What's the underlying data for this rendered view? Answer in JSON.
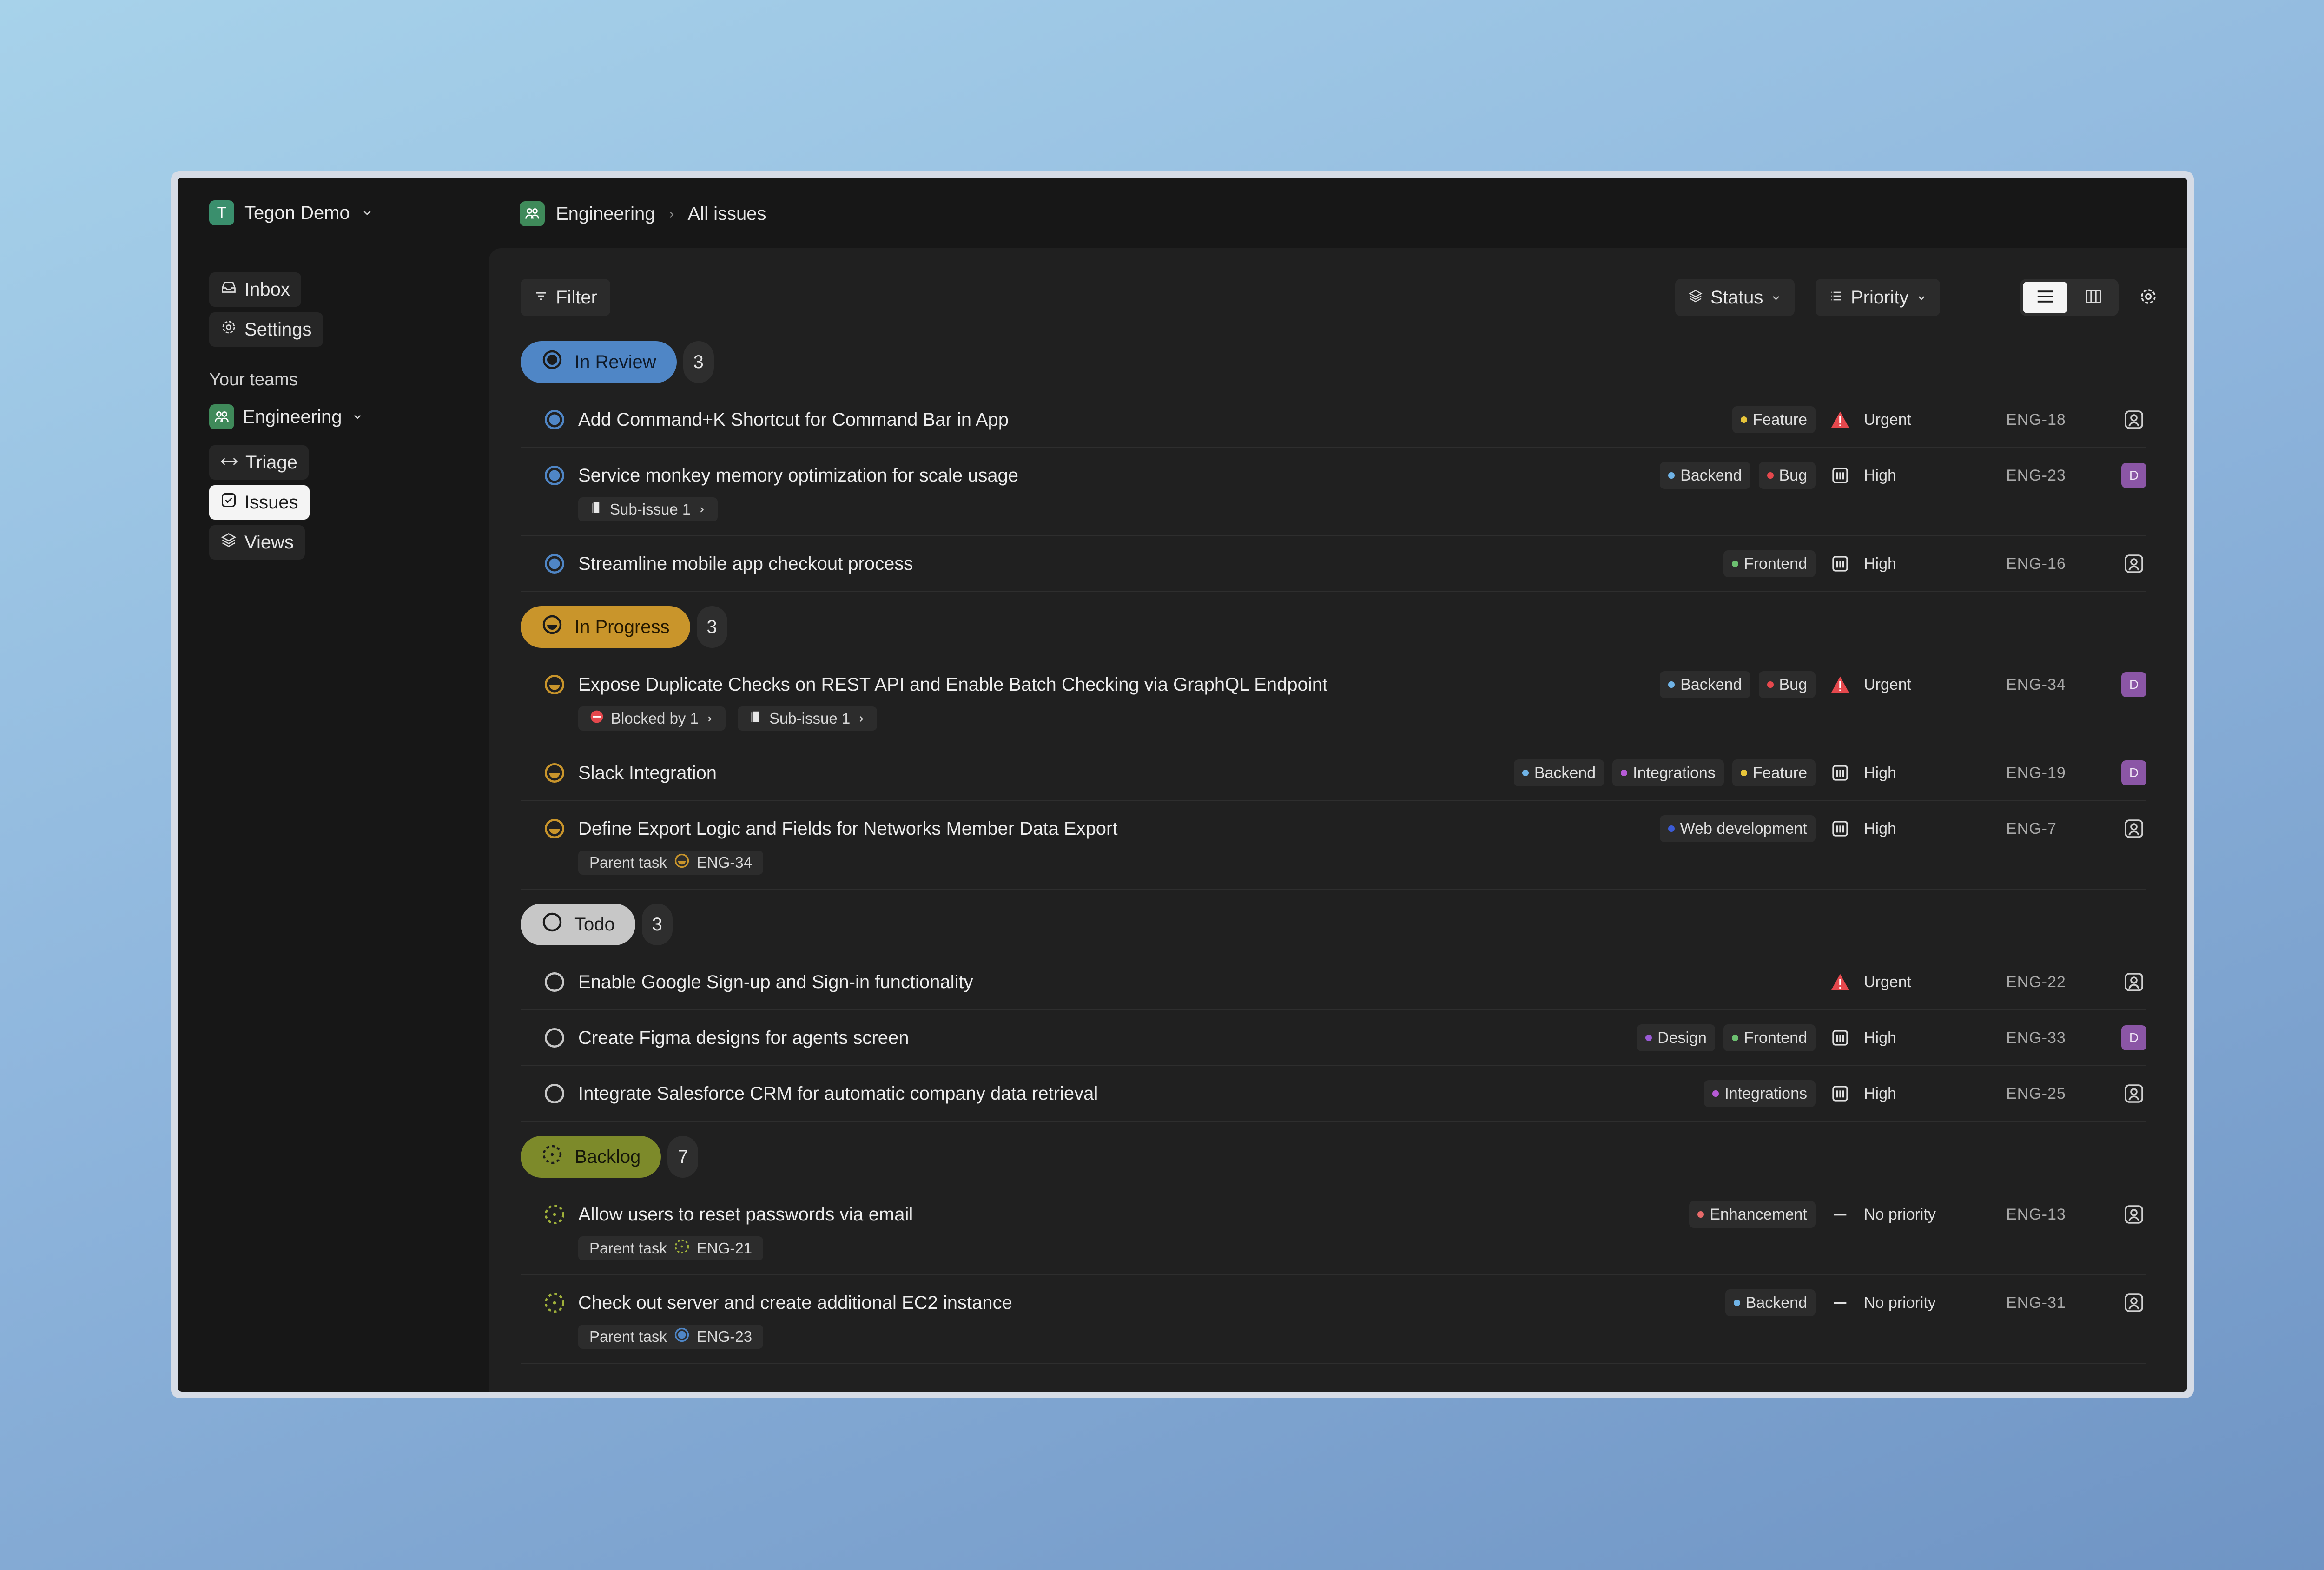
{
  "colors": {
    "in_review": "#4f86c6",
    "in_progress": "#c9952b",
    "todo": "#c7c7c7",
    "backlog": "#7d8a2a",
    "urgent": "#e5484d",
    "avatar": "#8b56a6"
  },
  "workspace": {
    "initial": "T",
    "name": "Tegon Demo"
  },
  "sidebar": {
    "inbox_label": "Inbox",
    "settings_label": "Settings",
    "teams_heading": "Your teams",
    "team_name": "Engineering",
    "triage_label": "Triage",
    "issues_label": "Issues",
    "views_label": "Views"
  },
  "breadcrumb": {
    "team": "Engineering",
    "page": "All issues"
  },
  "toolbar": {
    "filter_label": "Filter",
    "status_label": "Status",
    "priority_label": "Priority"
  },
  "groups": [
    {
      "name": "In Review",
      "count": "3",
      "issues": [
        {
          "title": "Add Command+K Shortcut for Command Bar in App",
          "labels": [
            "Feature"
          ],
          "priority": "Urgent",
          "key": "ENG-18",
          "assignee": ""
        },
        {
          "title": "Service monkey memory optimization for scale usage",
          "labels": [
            "Backend",
            "Bug"
          ],
          "sub": [
            "Sub-issue 1"
          ],
          "priority": "High",
          "key": "ENG-23",
          "assignee": "D"
        },
        {
          "title": "Streamline mobile app checkout process",
          "labels": [
            "Frontend"
          ],
          "priority": "High",
          "key": "ENG-16",
          "assignee": ""
        }
      ]
    },
    {
      "name": "In Progress",
      "count": "3",
      "issues": [
        {
          "title": "Expose Duplicate Checks on REST API and Enable Batch Checking via GraphQL Endpoint",
          "labels": [
            "Backend",
            "Bug"
          ],
          "sub": [
            "Blocked by 1",
            "Sub-issue 1"
          ],
          "priority": "Urgent",
          "key": "ENG-34",
          "assignee": "D"
        },
        {
          "title": "Slack Integration",
          "labels": [
            "Backend",
            "Integrations",
            "Feature"
          ],
          "priority": "High",
          "key": "ENG-19",
          "assignee": "D"
        },
        {
          "title": "Define Export Logic and Fields for Networks Member Data Export",
          "labels": [
            "Web development"
          ],
          "parent": {
            "label": "Parent task",
            "key": "ENG-34"
          },
          "priority": "High",
          "key": "ENG-7",
          "assignee": ""
        }
      ]
    },
    {
      "name": "Todo",
      "count": "3",
      "issues": [
        {
          "title": "Enable Google Sign-up and Sign-in functionality",
          "labels": [],
          "priority": "Urgent",
          "key": "ENG-22",
          "assignee": ""
        },
        {
          "title": "Create Figma designs for agents screen",
          "labels": [
            "Design",
            "Frontend"
          ],
          "priority": "High",
          "key": "ENG-33",
          "assignee": "D"
        },
        {
          "title": "Integrate Salesforce CRM for automatic company data retrieval",
          "labels": [
            "Integrations"
          ],
          "priority": "High",
          "key": "ENG-25",
          "assignee": ""
        }
      ]
    },
    {
      "name": "Backlog",
      "count": "7",
      "issues": [
        {
          "title": "Allow users to reset passwords via email",
          "labels": [
            "Enhancement"
          ],
          "parent": {
            "label": "Parent task",
            "key": "ENG-21"
          },
          "priority": "No priority",
          "key": "ENG-13",
          "assignee": ""
        },
        {
          "title": "Check out server and create additional EC2 instance",
          "labels": [
            "Backend"
          ],
          "parent": {
            "label": "Parent task",
            "key": "ENG-23"
          },
          "priority": "No priority",
          "key": "ENG-31",
          "assignee": ""
        }
      ]
    }
  ],
  "label_colors": {
    "Feature": "#e8c53a",
    "Backend": "#6fb3e6",
    "Bug": "#e5484d",
    "Frontend": "#6cc070",
    "Integrations": "#b65ad6",
    "Web development": "#3b5bd6",
    "Design": "#9a5ad6",
    "Enhancement": "#e86a6a"
  }
}
